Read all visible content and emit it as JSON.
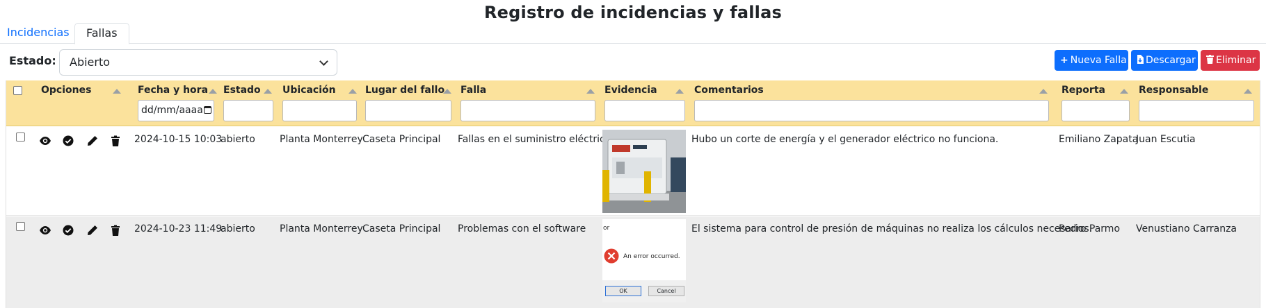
{
  "page_title": "Registro de incidencias y fallas",
  "tabs": [
    {
      "label": "Incidencias",
      "active": false
    },
    {
      "label": "Fallas",
      "active": true
    }
  ],
  "filter": {
    "label": "Estado:",
    "value": "Abierto"
  },
  "buttons": {
    "new": {
      "label": "Nueva Falla",
      "icon": "plus-icon",
      "color": "#0d6efd"
    },
    "download": {
      "label": "Descargar",
      "icon": "file-download-icon",
      "color": "#0d6efd"
    },
    "delete": {
      "label": "Eliminar",
      "icon": "trash-icon",
      "color": "#dc3545"
    }
  },
  "table": {
    "header_color": "#fbe29c",
    "columns": [
      {
        "key": "opciones",
        "label": "Opciones"
      },
      {
        "key": "fecha",
        "label": "Fecha y hora",
        "filter_placeholder": "dd/mm/aaaa"
      },
      {
        "key": "estado",
        "label": "Estado"
      },
      {
        "key": "ubicacion",
        "label": "Ubicación"
      },
      {
        "key": "lugar",
        "label": "Lugar del fallo"
      },
      {
        "key": "falla",
        "label": "Falla"
      },
      {
        "key": "evidencia",
        "label": "Evidencia"
      },
      {
        "key": "comentarios",
        "label": "Comentarios"
      },
      {
        "key": "reporta",
        "label": "Reporta"
      },
      {
        "key": "responsable",
        "label": "Responsable"
      }
    ],
    "rows": [
      {
        "fecha": "2024-10-15 10:03",
        "estado": "abierto",
        "ubicacion": "Planta Monterrey",
        "lugar": "Caseta Principal",
        "falla": "Fallas en el suministro eléctrico",
        "evidencia": "generator-photo",
        "comentarios": "Hubo un corte de energía y el generador eléctrico no funciona.",
        "reporta": "Emiliano Zapata",
        "responsable": "Juan Escutia"
      },
      {
        "fecha": "2024-10-23 11:49",
        "estado": "abierto",
        "ubicacion": "Planta Monterrey",
        "lugar": "Caseta Principal",
        "falla": "Problemas con el software",
        "evidencia": "error-dialog-screenshot",
        "evidence_text": {
          "title": "or",
          "message": "An error occurred.",
          "ok": "OK",
          "cancel": "Cancel"
        },
        "comentarios": "El sistema para control de presión de máquinas no realiza los cálculos necesarios.",
        "reporta": "Pedro Parmo",
        "responsable": "Venustiano Carranza"
      }
    ]
  }
}
